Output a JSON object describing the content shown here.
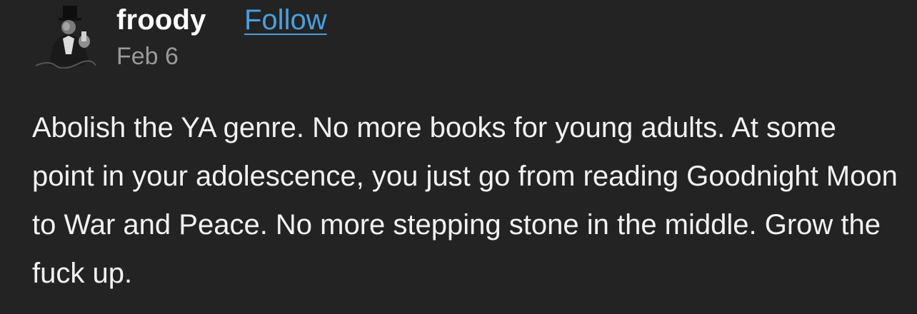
{
  "post": {
    "author": "froody",
    "follow_label": "Follow",
    "date": "Feb 6",
    "body": "Abolish the YA genre. No more books for young adults. At some point in your adolescence, you just go from reading Goodnight Moon to War and Peace. No more stepping stone in the middle. Grow the fuck up."
  },
  "colors": {
    "background": "#232323",
    "username": "#ffffff",
    "follow_link": "#4a9fe0",
    "date": "#9a9a9a",
    "body_text": "#f2f2f2"
  },
  "icons": {
    "avatar": "avatar-illustration-top-hat-man"
  }
}
